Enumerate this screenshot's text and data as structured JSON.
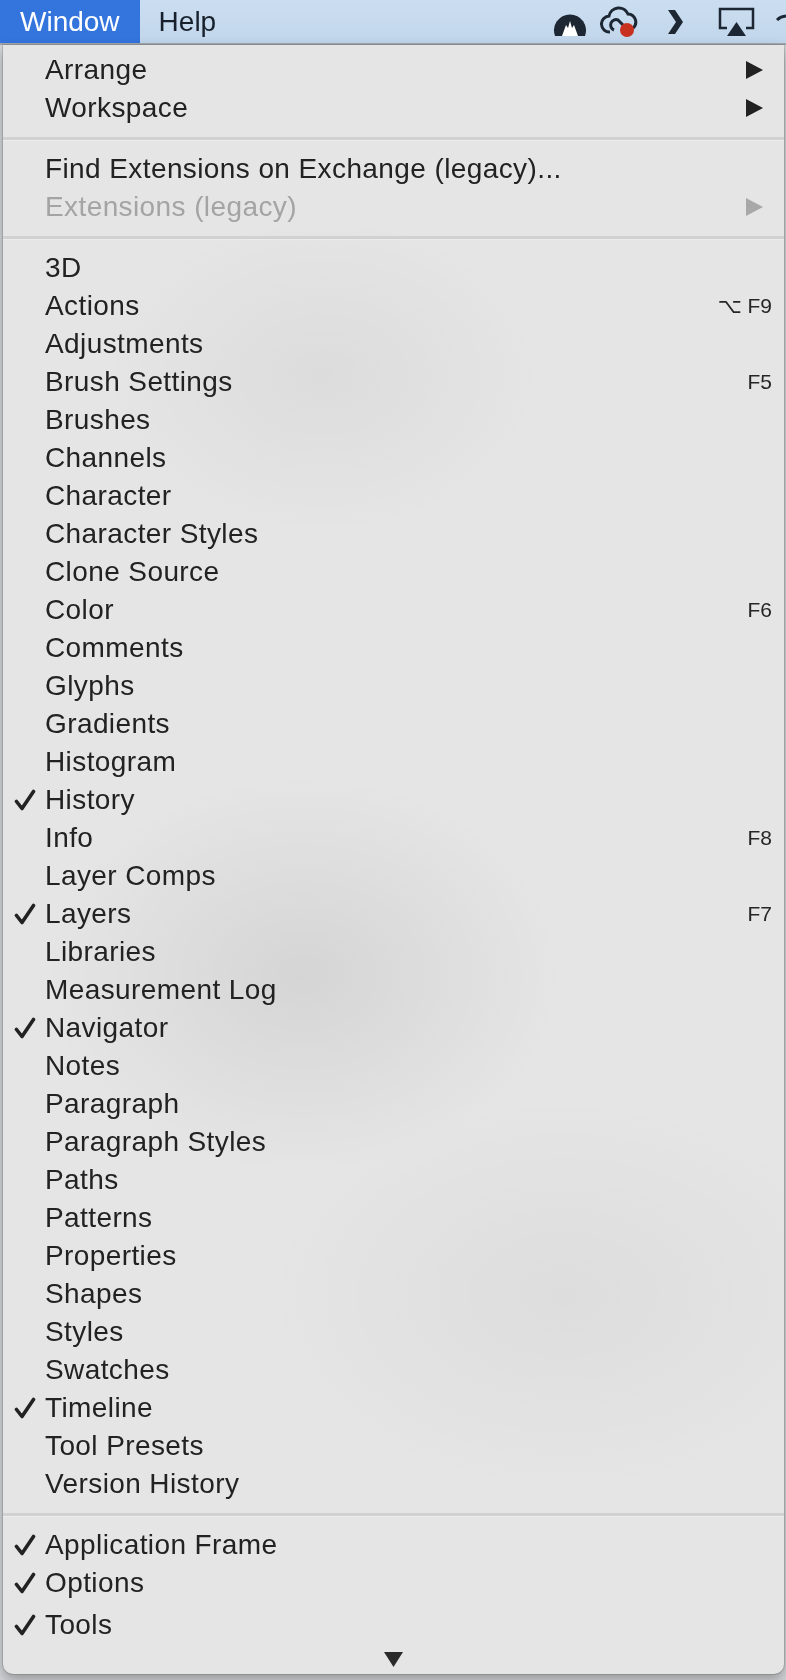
{
  "menu_bar": {
    "menus": [
      {
        "label": "Window",
        "selected": true
      },
      {
        "label": "Help",
        "selected": false
      }
    ]
  },
  "menu": {
    "sections": [
      {
        "items": [
          {
            "label": "Arrange",
            "checked": false,
            "disabled": false,
            "submenu": true
          },
          {
            "label": "Workspace",
            "checked": false,
            "disabled": false,
            "submenu": true
          }
        ]
      },
      {
        "items": [
          {
            "label": "Find Extensions on Exchange (legacy)...",
            "checked": false,
            "disabled": false,
            "submenu": false
          },
          {
            "label": "Extensions (legacy)",
            "checked": false,
            "disabled": true,
            "submenu": true
          }
        ]
      },
      {
        "items": [
          {
            "label": "3D",
            "checked": false,
            "disabled": false,
            "submenu": false
          },
          {
            "label": "Actions",
            "checked": false,
            "disabled": false,
            "submenu": false,
            "shortcut": "⌥ F9"
          },
          {
            "label": "Adjustments",
            "checked": false,
            "disabled": false,
            "submenu": false
          },
          {
            "label": "Brush Settings",
            "checked": false,
            "disabled": false,
            "submenu": false,
            "shortcut": "F5"
          },
          {
            "label": "Brushes",
            "checked": false,
            "disabled": false,
            "submenu": false
          },
          {
            "label": "Channels",
            "checked": false,
            "disabled": false,
            "submenu": false
          },
          {
            "label": "Character",
            "checked": false,
            "disabled": false,
            "submenu": false
          },
          {
            "label": "Character Styles",
            "checked": false,
            "disabled": false,
            "submenu": false
          },
          {
            "label": "Clone Source",
            "checked": false,
            "disabled": false,
            "submenu": false
          },
          {
            "label": "Color",
            "checked": false,
            "disabled": false,
            "submenu": false,
            "shortcut": "F6"
          },
          {
            "label": "Comments",
            "checked": false,
            "disabled": false,
            "submenu": false
          },
          {
            "label": "Glyphs",
            "checked": false,
            "disabled": false,
            "submenu": false
          },
          {
            "label": "Gradients",
            "checked": false,
            "disabled": false,
            "submenu": false
          },
          {
            "label": "Histogram",
            "checked": false,
            "disabled": false,
            "submenu": false
          },
          {
            "label": "History",
            "checked": true,
            "disabled": false,
            "submenu": false
          },
          {
            "label": "Info",
            "checked": false,
            "disabled": false,
            "submenu": false,
            "shortcut": "F8"
          },
          {
            "label": "Layer Comps",
            "checked": false,
            "disabled": false,
            "submenu": false
          },
          {
            "label": "Layers",
            "checked": true,
            "disabled": false,
            "submenu": false,
            "shortcut": "F7"
          },
          {
            "label": "Libraries",
            "checked": false,
            "disabled": false,
            "submenu": false
          },
          {
            "label": "Measurement Log",
            "checked": false,
            "disabled": false,
            "submenu": false
          },
          {
            "label": "Navigator",
            "checked": true,
            "disabled": false,
            "submenu": false
          },
          {
            "label": "Notes",
            "checked": false,
            "disabled": false,
            "submenu": false
          },
          {
            "label": "Paragraph",
            "checked": false,
            "disabled": false,
            "submenu": false
          },
          {
            "label": "Paragraph Styles",
            "checked": false,
            "disabled": false,
            "submenu": false
          },
          {
            "label": "Paths",
            "checked": false,
            "disabled": false,
            "submenu": false
          },
          {
            "label": "Patterns",
            "checked": false,
            "disabled": false,
            "submenu": false
          },
          {
            "label": "Properties",
            "checked": false,
            "disabled": false,
            "submenu": false
          },
          {
            "label": "Shapes",
            "checked": false,
            "disabled": false,
            "submenu": false
          },
          {
            "label": "Styles",
            "checked": false,
            "disabled": false,
            "submenu": false
          },
          {
            "label": "Swatches",
            "checked": false,
            "disabled": false,
            "submenu": false
          },
          {
            "label": "Timeline",
            "checked": true,
            "disabled": false,
            "submenu": false
          },
          {
            "label": "Tool Presets",
            "checked": false,
            "disabled": false,
            "submenu": false
          },
          {
            "label": "Version History",
            "checked": false,
            "disabled": false,
            "submenu": false
          }
        ]
      },
      {
        "items": [
          {
            "label": "Application Frame",
            "checked": true,
            "disabled": false,
            "submenu": false
          },
          {
            "label": "Options",
            "checked": true,
            "disabled": false,
            "submenu": false
          },
          {
            "label": "Tools",
            "checked": true,
            "disabled": false,
            "submenu": false
          }
        ]
      }
    ],
    "more_below": true
  }
}
